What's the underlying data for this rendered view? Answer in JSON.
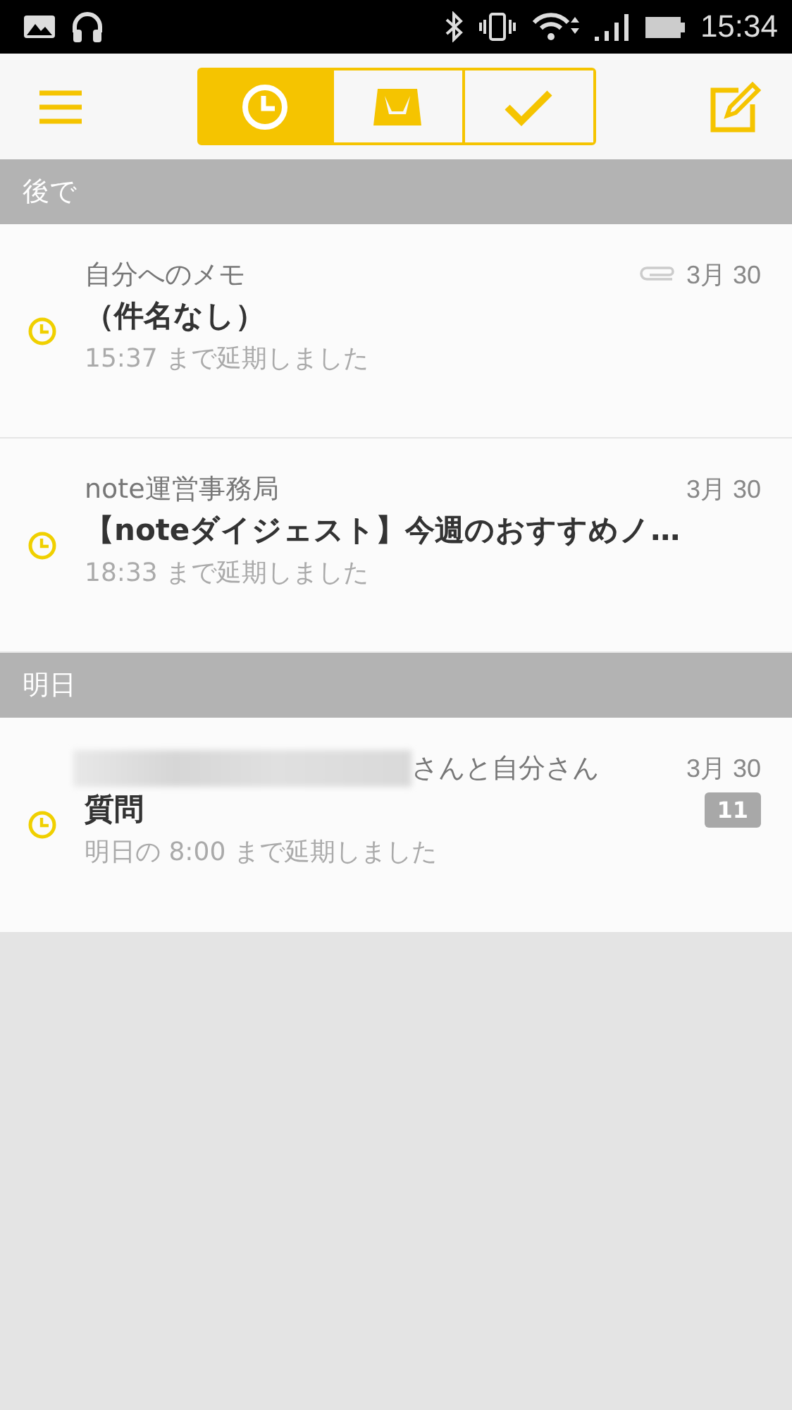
{
  "status_bar": {
    "time": "15:34"
  },
  "tabs": [
    {
      "kind": "clock",
      "selected": true
    },
    {
      "kind": "inbox",
      "selected": false
    },
    {
      "kind": "check",
      "selected": false
    }
  ],
  "sections": [
    {
      "title": "後で",
      "items": [
        {
          "sender": "自分へのメモ",
          "redacted": false,
          "subject": "（件名なし）",
          "snooze": "15:37 まで延期しました",
          "date": "3月 30",
          "attachment": true
        },
        {
          "sender": "note運営事務局",
          "redacted": false,
          "subject": "【noteダイジェスト】今週のおすすめノ…",
          "snooze": "18:33 まで延期しました",
          "date": "3月 30",
          "attachment": false
        }
      ]
    },
    {
      "title": "明日",
      "items": [
        {
          "sender": "さんと自分さん",
          "redacted": true,
          "subject": "質問",
          "snooze": "明日の 8:00 まで延期しました",
          "date": "3月 30",
          "attachment": false,
          "count": "11"
        }
      ]
    }
  ]
}
